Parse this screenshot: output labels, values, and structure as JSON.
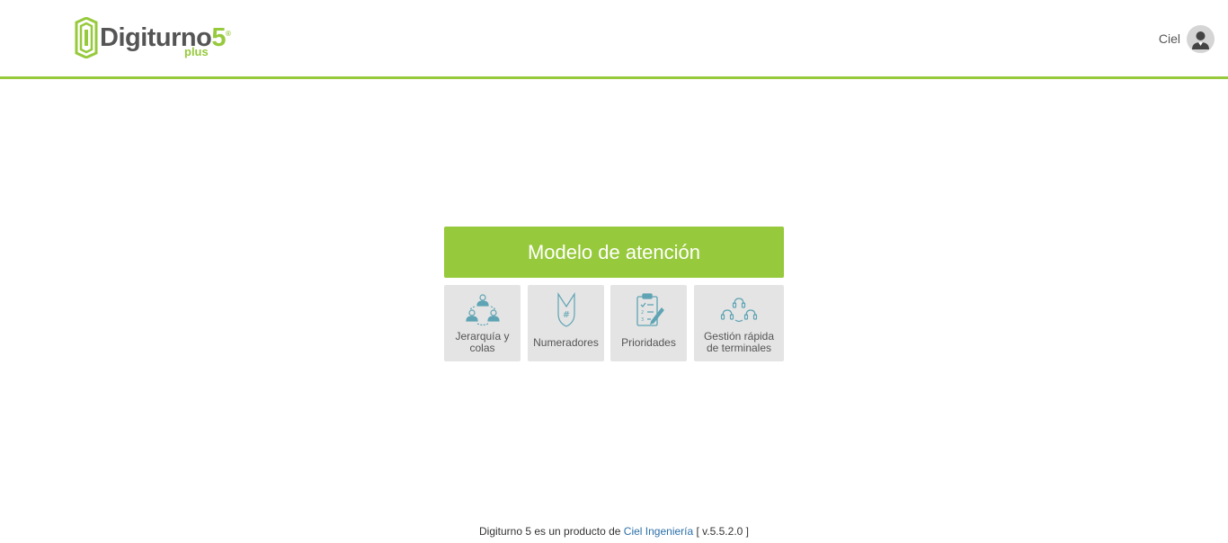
{
  "header": {
    "logo": {
      "name": "Digiturno",
      "version": "5",
      "reg": "®",
      "edition": "plus"
    },
    "user": {
      "name": "Ciel"
    }
  },
  "main": {
    "title": "Modelo de atención",
    "tiles": [
      {
        "label": "Jerarquía y colas",
        "icon": "hierarchy-users-icon"
      },
      {
        "label": "Numeradores",
        "icon": "numerator-ticket-icon"
      },
      {
        "label": "Prioridades",
        "icon": "clipboard-priority-icon"
      },
      {
        "label": "Gestión rápida de terminales",
        "icon": "headset-agents-icon"
      }
    ]
  },
  "footer": {
    "prefix": "Digiturno 5 es un producto de",
    "company": "Ciel Ingeniería",
    "version": "[ v.5.5.2.0 ]"
  },
  "colors": {
    "accent": "#97c93c",
    "tile_bg": "#e4e4e4",
    "icon": "#5ea4b4",
    "link": "#2a6fa8"
  }
}
